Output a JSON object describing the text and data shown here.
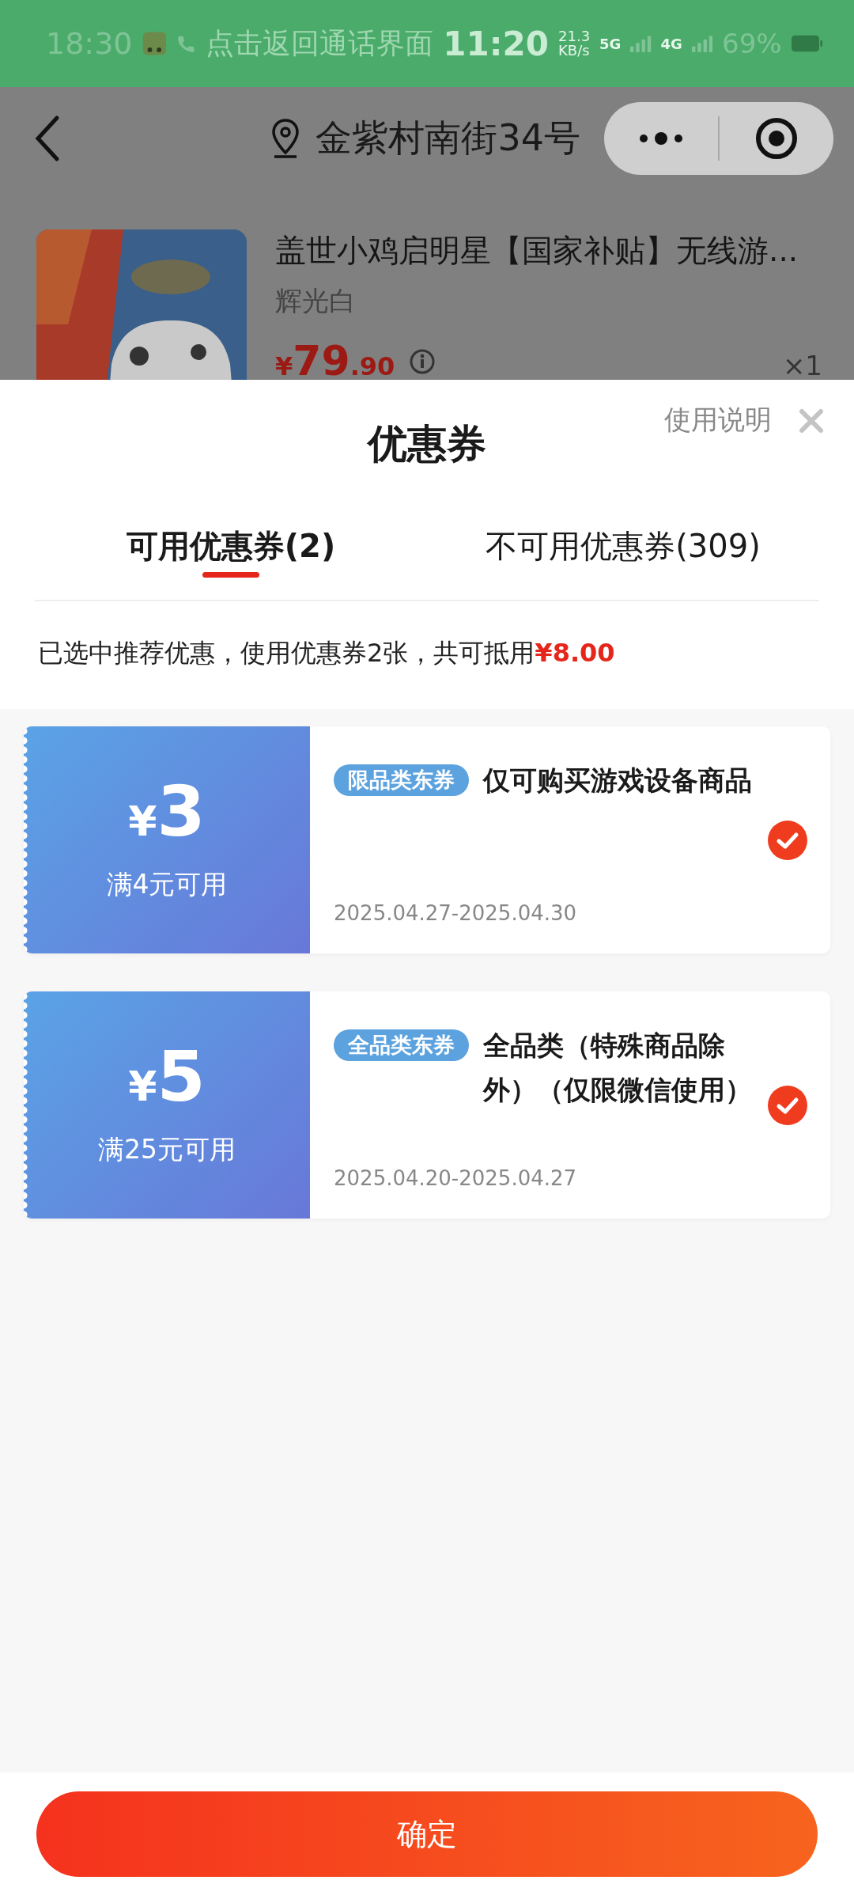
{
  "status_bar": {
    "time": "18:30",
    "call_banner": "点击返回通话界面",
    "call_time": "11:20",
    "speed": "21.3",
    "speed_unit": "KB/s",
    "network_1": "5G",
    "network_2": "4G",
    "battery": "69%"
  },
  "header": {
    "address": "金紫村南街34号"
  },
  "product": {
    "title": "盖世小鸡启明星【国家补贴】无线游...",
    "variant": "辉光白",
    "price_symbol": "¥",
    "price_int": "79",
    "price_dec": ".90",
    "quantity": "×1"
  },
  "sheet": {
    "help": "使用说明",
    "title": "优惠券",
    "tabs": [
      {
        "label": "可用优惠券(2)",
        "selected": true
      },
      {
        "label": "不可用优惠券(309)",
        "selected": false
      }
    ],
    "summary": "已选中推荐优惠，使用优惠券2张，共可抵用",
    "summary_amount": "¥8.00",
    "coupons": [
      {
        "symbol": "¥",
        "amount": "3",
        "condition": "满4元可用",
        "tag": "限品类东券",
        "title": "仅可购买游戏设备商品",
        "date": "2025.04.27-2025.04.30",
        "selected": true
      },
      {
        "symbol": "¥",
        "amount": "5",
        "condition": "满25元可用",
        "tag": "全品类东券",
        "title": "全品类（特殊商品除外）（仅限微信使用）",
        "date": "2025.04.20-2025.04.27",
        "selected": true
      }
    ],
    "confirm": "确定"
  }
}
